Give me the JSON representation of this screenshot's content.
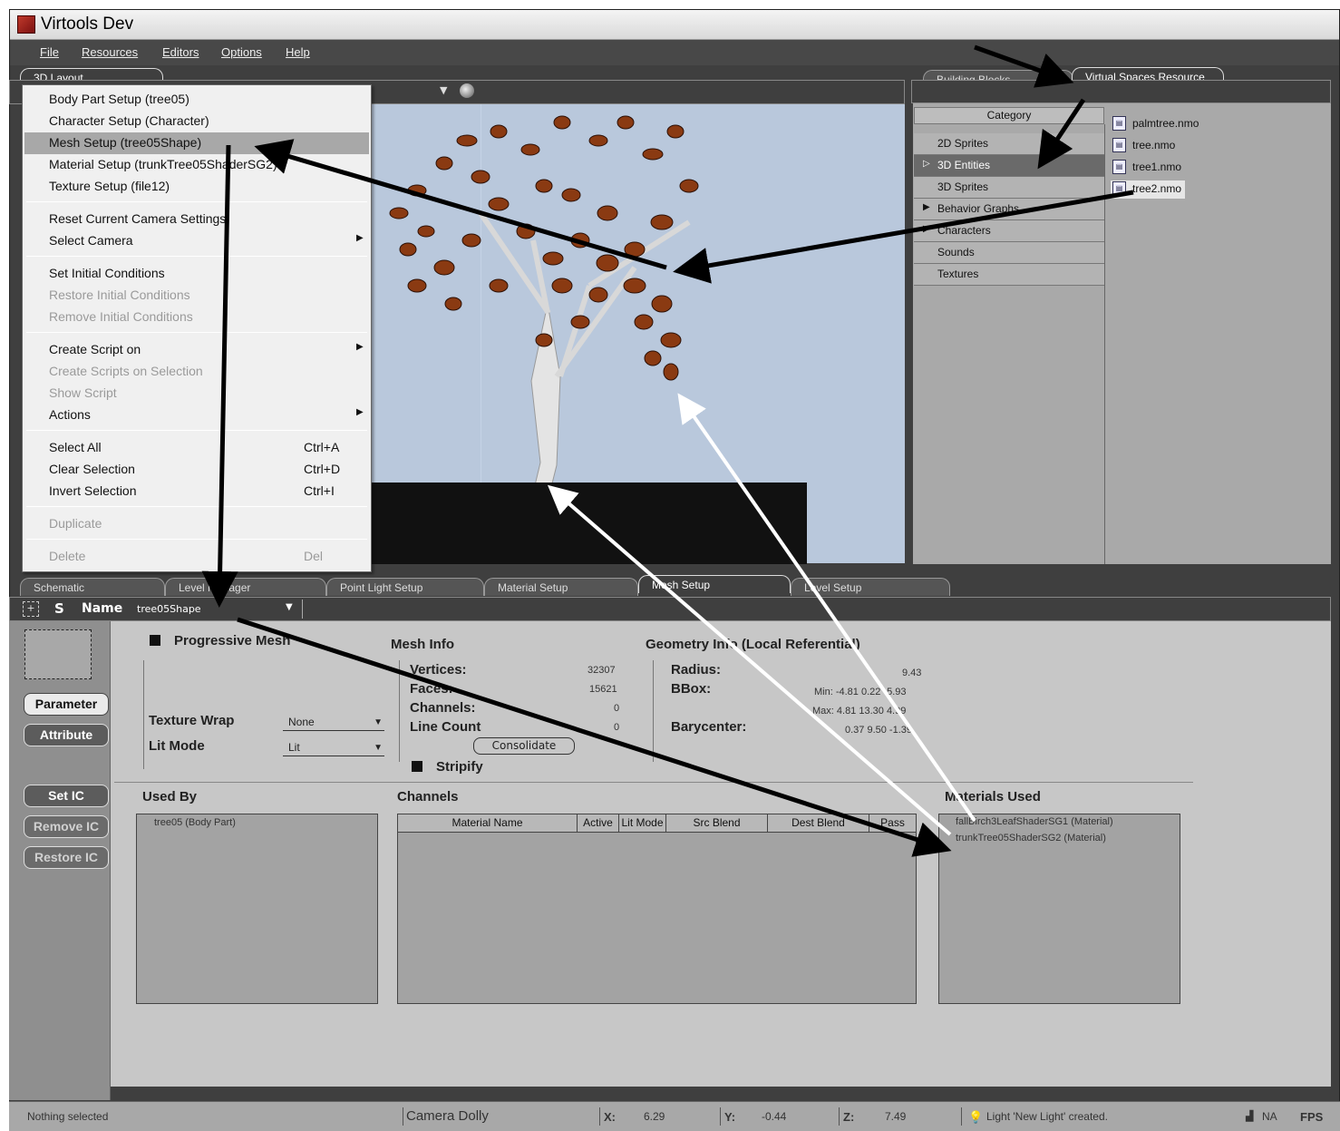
{
  "app": {
    "title": "Virtools Dev"
  },
  "menubar": [
    "File",
    "Resources",
    "Editors",
    "Options",
    "Help"
  ],
  "top_tabs": {
    "left": "3D Layout",
    "right": [
      "Building Blocks",
      "Virtual Spaces Resource"
    ]
  },
  "context_menu": {
    "items": [
      {
        "label": "Body Part Setup (tree05)"
      },
      {
        "label": "Character Setup (Character)"
      },
      {
        "label": "Mesh Setup (tree05Shape)"
      },
      {
        "label": "Material Setup (trunkTree05ShaderSG2)"
      },
      {
        "label": "Texture Setup (file12)"
      },
      {
        "label": "Reset Current Camera Settings"
      },
      {
        "label": "Select Camera"
      },
      {
        "label": "Set Initial Conditions"
      },
      {
        "label": "Restore Initial Conditions"
      },
      {
        "label": "Remove Initial Conditions"
      },
      {
        "label": "Create Script on"
      },
      {
        "label": "Create Scripts on Selection"
      },
      {
        "label": "Show Script"
      },
      {
        "label": "Actions"
      },
      {
        "label": "Select All",
        "shortcut": "Ctrl+A"
      },
      {
        "label": "Clear Selection",
        "shortcut": "Ctrl+D"
      },
      {
        "label": "Invert Selection",
        "shortcut": "Ctrl+I"
      },
      {
        "label": "Duplicate"
      },
      {
        "label": "Delete",
        "shortcut": "Del"
      }
    ]
  },
  "resources": {
    "category_header": "Category",
    "categories": [
      "2D Sprites",
      "3D Entities",
      "3D Sprites",
      "Behavior Graphs",
      "Characters",
      "Sounds",
      "Textures"
    ],
    "files": [
      "palmtree.nmo",
      "tree.nmo",
      "tree1.nmo",
      "tree2.nmo"
    ],
    "file_icon": "nmo-file-icon"
  },
  "bottom_tabs": [
    "Schematic",
    "Level Manager",
    "Point Light Setup",
    "Material Setup",
    "Mesh Setup",
    "Level Setup"
  ],
  "mesh_setup": {
    "s_label": "S",
    "name_label": "Name",
    "name_value": "tree05Shape",
    "left_buttons": [
      "Parameter",
      "Attribute",
      "Set IC",
      "Remove IC",
      "Restore IC"
    ],
    "progressive_mesh": "Progressive Mesh",
    "texture_wrap_label": "Texture Wrap",
    "texture_wrap_value": "None",
    "lit_mode_label": "Lit Mode",
    "lit_mode_value": "Lit",
    "mesh_info": {
      "title": "Mesh Info",
      "vertices_label": "Vertices:",
      "vertices": "32307",
      "faces_label": "Faces:",
      "faces": "15621",
      "channels_label": "Channels:",
      "channels": "0",
      "line_count_label": "Line Count",
      "line_count": "0",
      "consolidate": "Consolidate",
      "stripify": "Stripify"
    },
    "geometry_info": {
      "title": "Geometry Info (Local Referential)",
      "radius_label": "Radius:",
      "radius": "9.43",
      "bbox_label": "BBox:",
      "bbox_min": "Min: -4.81 0.22 -5.93",
      "bbox_max": "Max: 4.81 13.30 4.99",
      "barycenter_label": "Barycenter:",
      "barycenter": "0.37 9.50 -1.39"
    },
    "used_by": {
      "title": "Used By",
      "items": [
        "tree05 (Body Part)"
      ]
    },
    "channels": {
      "title": "Channels",
      "columns": [
        "Material Name",
        "Active",
        "Lit Mode",
        "Src Blend",
        "Dest Blend",
        "Pass"
      ]
    },
    "materials_used": {
      "title": "Materials Used",
      "items": [
        "fallBirch3LeafShaderSG1 (Material)",
        "trunkTree05ShaderSG2 (Material)"
      ]
    }
  },
  "status": {
    "selection": "Nothing selected",
    "mode": "Camera Dolly",
    "x_label": "X:",
    "x": "6.29",
    "y_label": "Y:",
    "y": "-0.44",
    "z_label": "Z:",
    "z": "7.49",
    "message": "Light 'New Light' created.",
    "na": "NA",
    "fps": "FPS"
  }
}
